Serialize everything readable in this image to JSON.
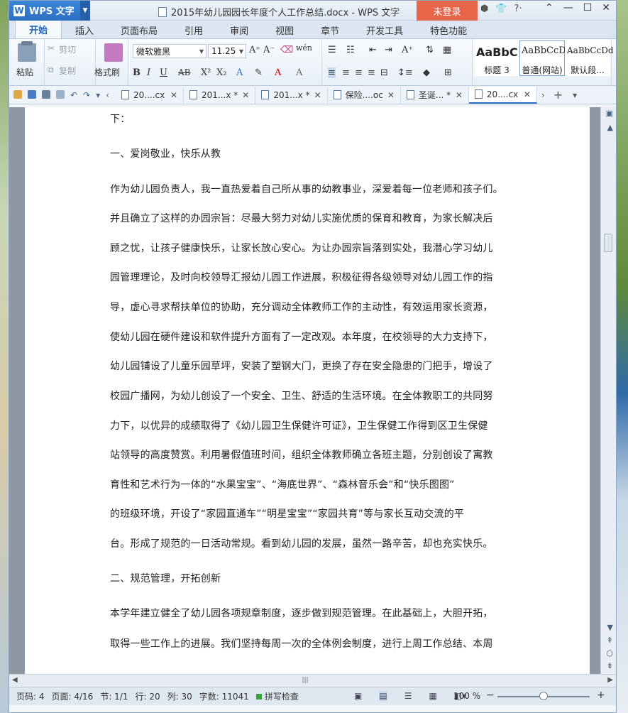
{
  "app": {
    "name": "WPS 文字",
    "logo": "W",
    "login_label": "未登录"
  },
  "window": {
    "title": "2015年幼儿园园长年度个人工作总结.docx - WPS 文字"
  },
  "ribbon_tabs": [
    "开始",
    "插入",
    "页面布局",
    "引用",
    "审阅",
    "视图",
    "章节",
    "开发工具",
    "特色功能"
  ],
  "clipboard": {
    "paste": "粘贴",
    "cut": "剪切",
    "copy": "复制",
    "format_painter": "格式刷"
  },
  "font": {
    "name": "微软雅黑",
    "size": "11.25"
  },
  "styles": [
    {
      "sample": "AaBbC",
      "name": "标题 3"
    },
    {
      "sample": "AaBbCcD",
      "name": "普通(网站)"
    },
    {
      "sample": "AaBbCcDd",
      "name": "默认段..."
    }
  ],
  "doc_tabs": [
    "20....cx",
    "201...x *",
    "201...x *",
    "保险....oc",
    "圣诞... *",
    "20....cx"
  ],
  "document": {
    "lines": [
      "下：",
      "一、爱岗敬业，快乐从教",
      "作为幼儿园负责人，我一直热爱着自己所从事的幼教事业，深爱着每一位老师和孩子们。",
      "并且确立了这样的办园宗旨：尽最大努力对幼儿实施优质的保育和教育，为家长解决后",
      "顾之忧，让孩子健康快乐，让家长放心安心。为让办园宗旨落到实处，我潜心学习幼儿",
      "园管理理论，及时向校领导汇报幼儿园工作进展，积极征得各级领导对幼儿园工作的指",
      "导，虚心寻求帮扶单位的协助，充分调动全体教师工作的主动性，有效运用家长资源，",
      "使幼儿园在硬件建设和软件提升方面有了一定改观。本年度，在校领导的大力支持下，",
      "幼儿园铺设了儿童乐园草坪，安装了塑钢大门，更换了存在安全隐患的门把手，增设了",
      "校园广播网，为幼儿创设了一个安全、卫生、舒适的生活环境。在全体教职工的共同努",
      "力下，以优异的成绩取得了《幼儿园卫生保健许可证》，卫生保健工作得到区卫生保健",
      "站领导的高度赞赏。利用暑假值班时间，组织全体教师确立各班主题，分别创设了寓教",
      "育性和艺术行为一体的“水果宝宝”、“海底世界”、“森林音乐会”和“快乐图图”",
      "的班级环境，开设了“家园直通车”“明星宝宝”“家园共育”等与家长互动交流的平",
      "台。形成了规范的一日活动常规。看到幼儿园的发展，虽然一路辛苦，却也充实快乐。",
      "二、规范管理，开拓创新",
      "本学年建立健全了幼儿园各项规章制度，逐步做到规范管理。在此基础上，大胆开拓，",
      "取得一些工作上的进展。我们坚持每周一次的全体例会制度，进行上周工作总结、本周"
    ]
  },
  "status": {
    "page_code": "页码: 4",
    "pages": "页面: 4/16",
    "section": "节: 1/1",
    "row": "行: 20",
    "col": "列: 30",
    "words": "字数: 11041",
    "spell": "拼写检查",
    "zoom": "100 %",
    "zoom_level": 0.5
  },
  "colors": {
    "accent": "#2a6fc2",
    "login": "#e8654a"
  }
}
